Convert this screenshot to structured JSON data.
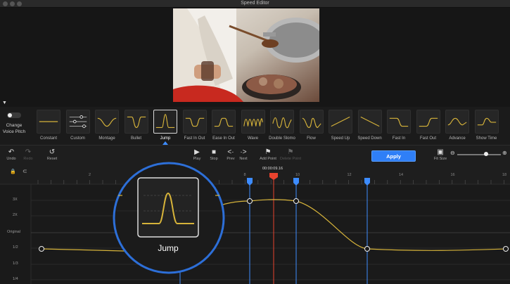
{
  "window": {
    "title": "Speed Editor"
  },
  "toggle": {
    "label_line1": "Change",
    "label_line2": "Voice Pitch"
  },
  "presets": [
    {
      "name": "Constant",
      "icon": "constant-curve-icon"
    },
    {
      "name": "Custom",
      "icon": "custom-sliders-icon"
    },
    {
      "name": "Montage",
      "icon": "montage-curve-icon"
    },
    {
      "name": "Bullet",
      "icon": "bullet-curve-icon"
    },
    {
      "name": "Jump",
      "icon": "jump-curve-icon"
    },
    {
      "name": "Fast In Out",
      "icon": "fast-in-out-curve-icon"
    },
    {
      "name": "Ease In Out",
      "icon": "ease-in-out-curve-icon"
    },
    {
      "name": "Wave",
      "icon": "wave-curve-icon"
    },
    {
      "name": "Double Slomo",
      "icon": "double-slomo-curve-icon"
    },
    {
      "name": "Flow",
      "icon": "flow-curve-icon"
    },
    {
      "name": "Speed Up",
      "icon": "speed-up-curve-icon"
    },
    {
      "name": "Speed Down",
      "icon": "speed-down-curve-icon"
    },
    {
      "name": "Fast In",
      "icon": "fast-in-curve-icon"
    },
    {
      "name": "Fast Out",
      "icon": "fast-out-curve-icon"
    },
    {
      "name": "Advance",
      "icon": "advance-curve-icon"
    },
    {
      "name": "Show Time",
      "icon": "show-time-curve-icon"
    }
  ],
  "selected_preset": "Jump",
  "toolbar": {
    "undo": "Undo",
    "redo": "Redo",
    "reset": "Reset",
    "play": "Play",
    "stop": "Stop",
    "prev": "Prev",
    "next": "Next",
    "add_point": "Add Point",
    "delete_point": "Delete Point",
    "apply": "Apply",
    "fit_size": "Fit Size"
  },
  "timeline": {
    "current_time": "00:00:09.16",
    "ruler_labels": [
      "2",
      "4",
      "6",
      "8",
      "10",
      "12",
      "14",
      "16",
      "18"
    ],
    "row_labels": [
      "3X",
      "2X",
      "Original",
      "1/2",
      "1/3",
      "1/4"
    ]
  },
  "magnifier": {
    "label": "Jump"
  },
  "colors": {
    "accent": "#3d8cff",
    "curve": "#d6b33a",
    "playhead": "#e8432e",
    "apply": "#2f7ff7"
  }
}
